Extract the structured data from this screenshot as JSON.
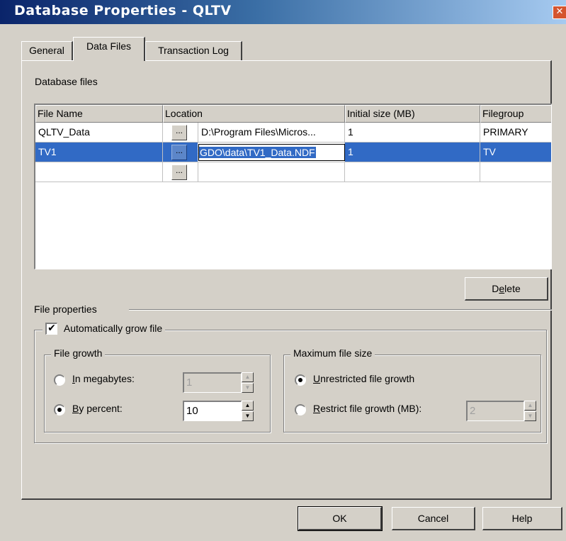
{
  "window": {
    "title": "Database Properties - QLTV",
    "close_glyph": "✕"
  },
  "tabs": [
    {
      "label": "General"
    },
    {
      "label": "Data Files"
    },
    {
      "label": "Transaction Log"
    }
  ],
  "database_files": {
    "section_label": "Database files",
    "columns": [
      "File Name",
      "Location",
      "Initial size (MB)",
      "Filegroup"
    ],
    "browse_label": "...",
    "rows": [
      {
        "file_name": "QLTV_Data",
        "location": "D:\\Program Files\\Micros...",
        "initial_size": "1",
        "filegroup": "PRIMARY"
      },
      {
        "file_name": "TV1",
        "location": "GDO\\data\\TV1_Data.NDF",
        "initial_size": "1",
        "filegroup": "TV"
      },
      {
        "file_name": "",
        "location": "",
        "initial_size": "",
        "filegroup": ""
      }
    ]
  },
  "delete_button": {
    "label_pre": "D",
    "label_u": "e",
    "label_post": "lete"
  },
  "file_properties": {
    "section_label": "File properties",
    "auto_grow": {
      "label": "Automatically grow file",
      "checked": true,
      "check_glyph": "✔"
    },
    "file_growth": {
      "label": "File growth",
      "in_megabytes": {
        "label_u": "I",
        "label_post": "n megabytes:",
        "value": "1"
      },
      "by_percent": {
        "label_u": "B",
        "label_post": "y percent:",
        "value": "10"
      }
    },
    "max_size": {
      "label": "Maximum file size",
      "unrestricted": {
        "label_u": "U",
        "label_post": "nrestricted file growth"
      },
      "restrict": {
        "label_u": "R",
        "label_post": "estrict file growth (MB):",
        "value": "2"
      }
    }
  },
  "footer": {
    "ok": "OK",
    "cancel": "Cancel",
    "help": "Help"
  },
  "spin_glyphs": {
    "up": "▲",
    "down": "▼"
  }
}
